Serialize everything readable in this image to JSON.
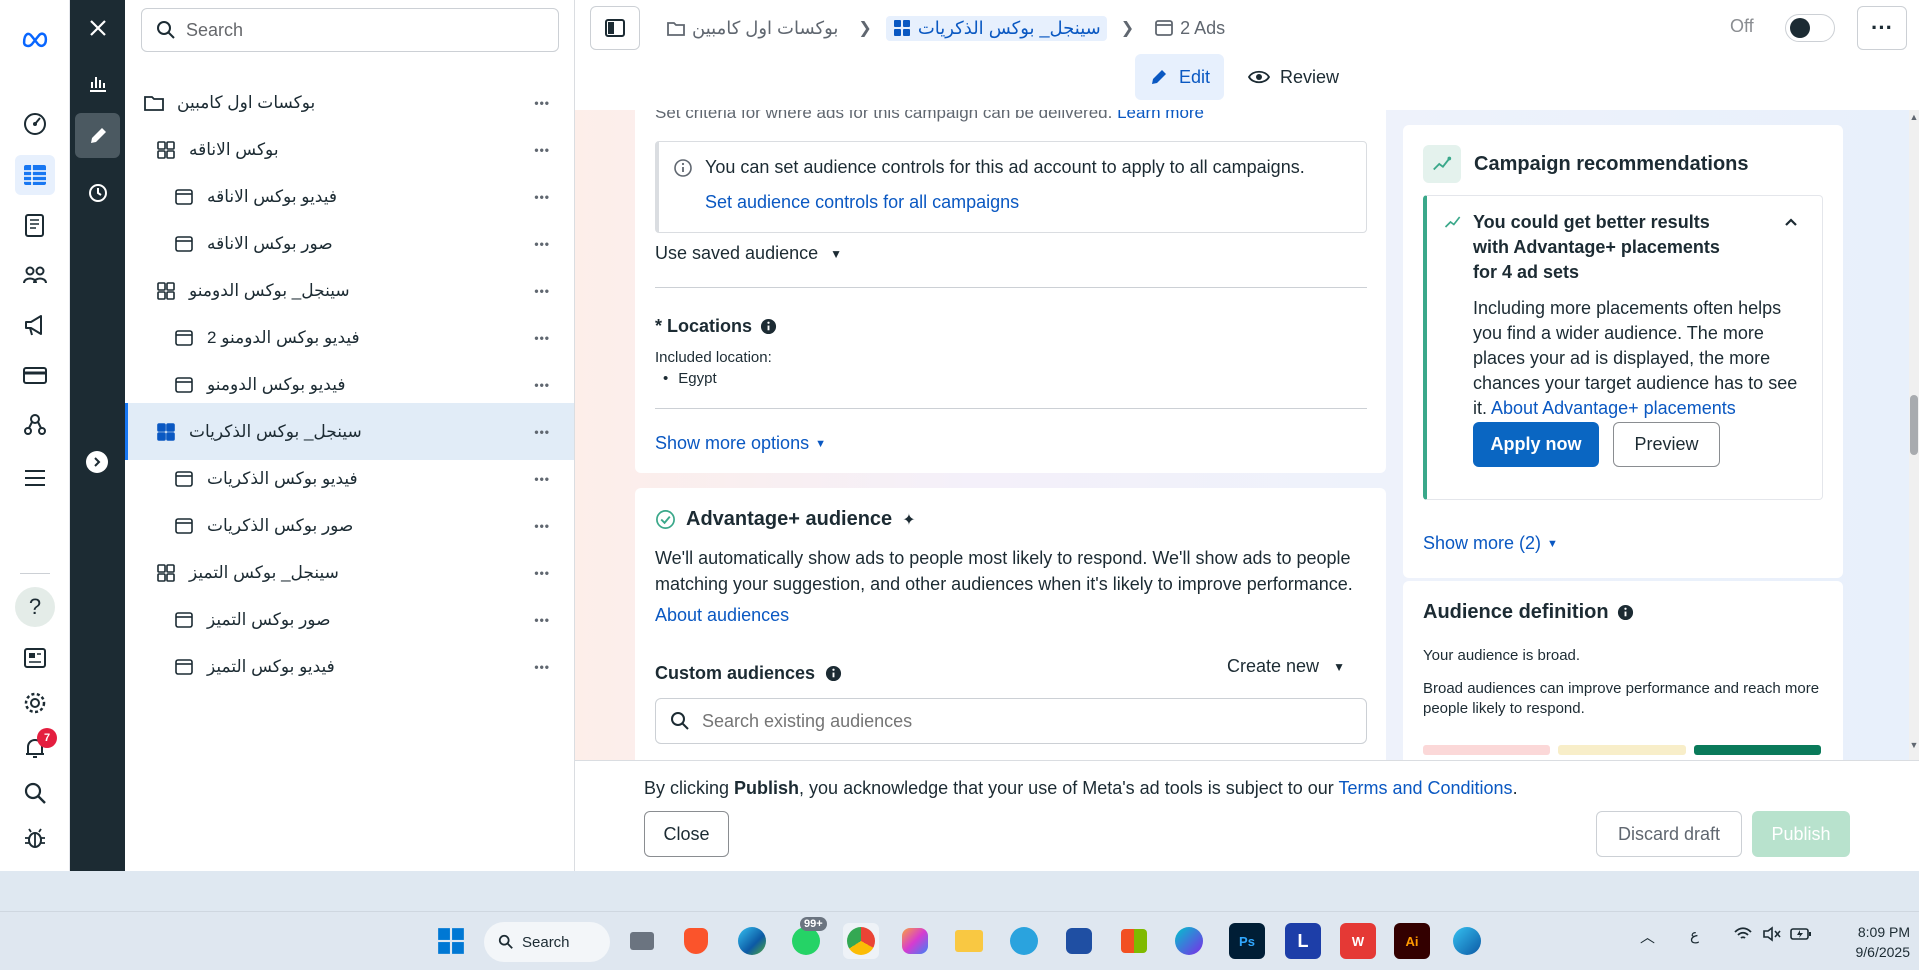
{
  "tree": {
    "search_placeholder": "Search",
    "items": [
      {
        "label": "بوكسات اول كامبين",
        "type": "campaign",
        "level": 0,
        "selected": false
      },
      {
        "label": "بوكس الاناقه",
        "type": "adset",
        "level": 1,
        "selected": false
      },
      {
        "label": "فيديو بوكس الاناقه",
        "type": "ad",
        "level": 2,
        "selected": false
      },
      {
        "label": "صور بوكس الاناقه",
        "type": "ad",
        "level": 2,
        "selected": false
      },
      {
        "label": "سينجل_ بوكس الدومنو",
        "type": "adset",
        "level": 1,
        "selected": false
      },
      {
        "label": "2 فيديو بوكس الدومنو",
        "type": "ad",
        "level": 2,
        "selected": false
      },
      {
        "label": "فيديو بوكس الدومنو",
        "type": "ad",
        "level": 2,
        "selected": false
      },
      {
        "label": "سينجل_ بوكس الذكريات",
        "type": "adset",
        "level": 1,
        "selected": true
      },
      {
        "label": "فيديو بوكس الذكريات",
        "type": "ad",
        "level": 2,
        "selected": false
      },
      {
        "label": "صور بوكس الذكريات",
        "type": "ad",
        "level": 2,
        "selected": false
      },
      {
        "label": "سينجل_ بوكس التميز",
        "type": "adset",
        "level": 1,
        "selected": false
      },
      {
        "label": "صور بوكس التميز",
        "type": "ad",
        "level": 2,
        "selected": false
      },
      {
        "label": "فيديو بوكس التميز",
        "type": "ad",
        "level": 2,
        "selected": false
      }
    ]
  },
  "header": {
    "breadcrumb": {
      "campaign": "بوكسات اول كامبين",
      "adset": "سينجل_ بوكس الذكريات",
      "ads": "2 Ads"
    },
    "toggle_label": "Off",
    "tabs": {
      "edit": "Edit",
      "review": "Review"
    }
  },
  "audience_section": {
    "cutoff_text": "Set criteria for where ads for this campaign can be delivered.",
    "cutoff_link": "Learn more",
    "info_text": "You can set audience controls for this ad account to apply to all campaigns.",
    "info_link": "Set audience controls for all campaigns",
    "saved_audience": "Use saved audience",
    "locations_label": "* Locations",
    "included_location_label": "Included location:",
    "location_value": "Egypt",
    "show_more_options": "Show more options"
  },
  "advantage": {
    "title": "Advantage+ audience",
    "description_line1": "We'll automatically show ads to people most likely to respond. We'll show ads to people",
    "description_line2": "matching your suggestion, and other audiences when it's likely to improve performance.",
    "about_link": "About audiences",
    "custom_label": "Custom audiences",
    "create_new": "Create new",
    "search_placeholder": "Search existing audiences"
  },
  "recommendations": {
    "title": "Campaign recommendations",
    "rec_title_line1": "You could get better results",
    "rec_title_line2": "with Advantage+ placements",
    "rec_title_line3": "for 4 ad sets",
    "rec_body_line1": "Including more placements often helps",
    "rec_body_line2": "you find a wider audience. The more",
    "rec_body_line3": "places your ad is displayed, the more",
    "rec_body_line4": "chances your target audience has to see",
    "rec_body_line5": "it.",
    "rec_link": "About Advantage+ placements",
    "apply_button": "Apply now",
    "preview_button": "Preview",
    "show_more": "Show more (2)"
  },
  "audience_definition": {
    "title": "Audience definition",
    "status": "Your audience is broad.",
    "body_line1": "Broad audiences can improve performance and reach more",
    "body_line2": "people likely to respond."
  },
  "footer": {
    "notice_prefix": "By clicking ",
    "notice_bold": "Publish",
    "notice_mid": ", you acknowledge that your use of Meta's ad tools is subject to our ",
    "notice_link": "Terms and Conditions",
    "notice_end": ".",
    "close_button": "Close",
    "discard_button": "Discard draft",
    "publish_button": "Publish"
  },
  "rail": {
    "notification_count": "7"
  },
  "taskbar": {
    "search_label": "Search",
    "whatsapp_badge": "99+",
    "lang": "ع",
    "time": "8:09 PM",
    "date": "9/6/2025"
  },
  "colors": {
    "accent": "#0a66c2",
    "link": "#0a58c2",
    "dark_column": "#1c2b33",
    "selected_row": "#e1ecf7",
    "recommendation_bar": "#3aa88a",
    "notification_red": "#e41e3f"
  }
}
